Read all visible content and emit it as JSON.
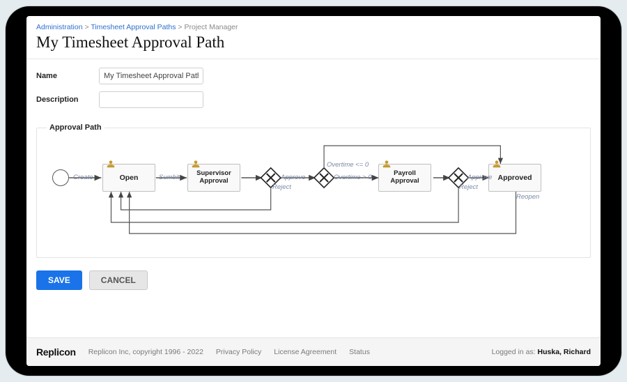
{
  "breadcrumbs": {
    "admin": "Administration",
    "paths": "Timesheet Approval Paths",
    "current": "Project Manager"
  },
  "page_title": "My Timesheet Approval Path",
  "form": {
    "name_label": "Name",
    "name_value": "My Timesheet Approval Path",
    "desc_label": "Description",
    "desc_value": ""
  },
  "path_section_label": "Approval Path",
  "flow": {
    "create": "Create",
    "open": "Open",
    "submit": "Sumbit",
    "supervisor": "Supervisor Approval",
    "approve1": "Approve",
    "reject1": "Reject",
    "ot_le0": "Overtime <= 0",
    "ot_gt0": "Overtime > 0",
    "payroll": "Payroll Approval",
    "approve2": "Approve",
    "reject2": "Reject",
    "approved": "Approved",
    "reopen": "Reopen"
  },
  "buttons": {
    "save": "SAVE",
    "cancel": "CANCEL"
  },
  "footer": {
    "brand": "Replicon",
    "copyright": "Replicon Inc, copyright 1996 - 2022",
    "privacy": "Privacy Policy",
    "license": "License Agreement",
    "status": "Status",
    "logged_in_label": "Logged in as: ",
    "user": "Huska, Richard"
  }
}
